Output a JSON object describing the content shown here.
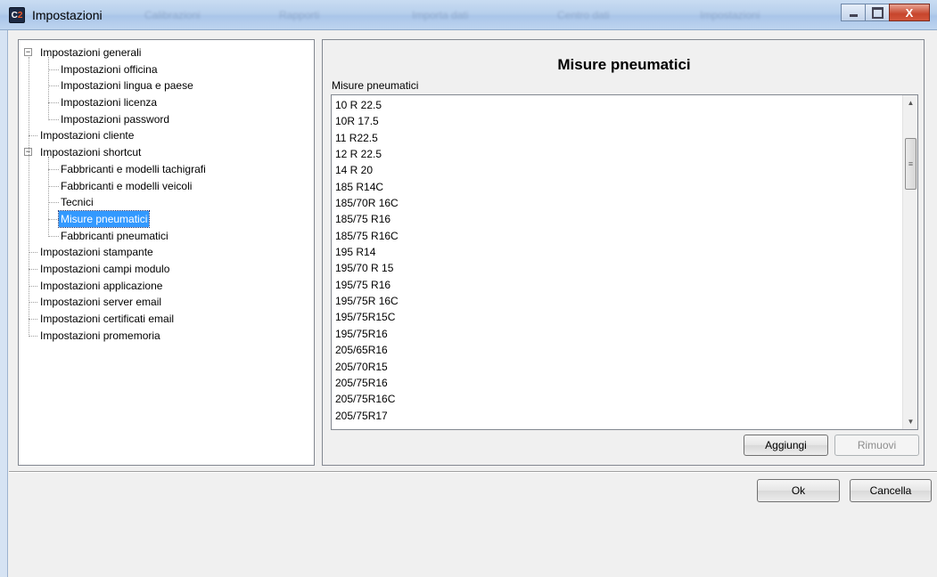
{
  "window": {
    "app_icon_text": "C",
    "app_icon_accent": "2",
    "title": "Impostazioni",
    "background_tabs": [
      "Calibrazioni",
      "Rapporti",
      "Importa dati",
      "Centro dati",
      "Impostazioni"
    ],
    "close_label": "X"
  },
  "tree": {
    "items": [
      {
        "label": "Impostazioni generali",
        "level": 0,
        "expander": "−"
      },
      {
        "label": "Impostazioni officina",
        "level": 1
      },
      {
        "label": "Impostazioni lingua e paese",
        "level": 1
      },
      {
        "label": "Impostazioni licenza",
        "level": 1
      },
      {
        "label": "Impostazioni password",
        "level": 1
      },
      {
        "label": "Impostazioni cliente",
        "level": 0
      },
      {
        "label": "Impostazioni shortcut",
        "level": 0,
        "expander": "−"
      },
      {
        "label": "Fabbricanti e modelli tachigrafi",
        "level": 1
      },
      {
        "label": "Fabbricanti e modelli veicoli",
        "level": 1
      },
      {
        "label": "Tecnici",
        "level": 1
      },
      {
        "label": "Misure pneumatici",
        "level": 1,
        "selected": true
      },
      {
        "label": "Fabbricanti pneumatici",
        "level": 1
      },
      {
        "label": "Impostazioni stampante",
        "level": 0
      },
      {
        "label": "Impostazioni campi modulo",
        "level": 0
      },
      {
        "label": "Impostazioni applicazione",
        "level": 0
      },
      {
        "label": "Impostazioni server email",
        "level": 0
      },
      {
        "label": "Impostazioni certificati email",
        "level": 0
      },
      {
        "label": "Impostazioni promemoria",
        "level": 0
      }
    ]
  },
  "panel": {
    "title": "Misure pneumatici",
    "list_label": "Misure pneumatici",
    "list_items": [
      "10 R 22.5",
      "10R 17.5",
      "11 R22.5",
      "12 R 22.5",
      "14 R 20",
      "185 R14C",
      "185/70R 16C",
      "185/75 R16",
      "185/75 R16C",
      "195 R14",
      "195/70 R 15",
      "195/75 R16",
      "195/75R 16C",
      "195/75R15C",
      "195/75R16",
      "205/65R16",
      "205/70R15",
      "205/75R16",
      "205/75R16C",
      "205/75R17"
    ],
    "add_button": "Aggiungi",
    "remove_button": "Rimuovi"
  },
  "footer": {
    "ok_button": "Ok",
    "cancel_button": "Cancella"
  },
  "colors": {
    "selection": "#3399ff",
    "titlebar": "#b7cfec",
    "close_button": "#c7452c"
  }
}
